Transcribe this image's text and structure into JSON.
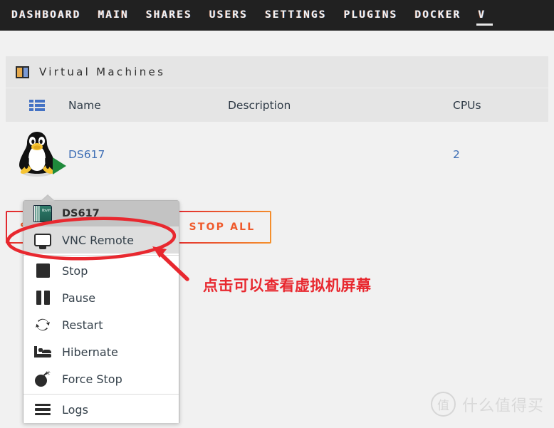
{
  "nav": {
    "items": [
      {
        "label": "DASHBOARD",
        "active": false
      },
      {
        "label": "MAIN",
        "active": false
      },
      {
        "label": "SHARES",
        "active": false
      },
      {
        "label": "USERS",
        "active": false
      },
      {
        "label": "SETTINGS",
        "active": false
      },
      {
        "label": "PLUGINS",
        "active": false
      },
      {
        "label": "DOCKER",
        "active": false
      },
      {
        "label": "V",
        "active": true
      }
    ]
  },
  "panel": {
    "title": "Virtual Machines",
    "icon": "panels-icon"
  },
  "table": {
    "headers": {
      "icon": "list-view-icon",
      "name": "Name",
      "description": "Description",
      "cpus": "CPUs"
    },
    "rows": [
      {
        "icon": "tux-penguin-icon",
        "state_icon": "play-triangle-icon",
        "name": "DS617",
        "description": "",
        "cpus": "2"
      }
    ]
  },
  "buttons": {
    "start_all": "START ALL",
    "stop_all": "STOP ALL"
  },
  "context_menu": {
    "header": {
      "label": "DS617",
      "icon": "libvirt-book-icon"
    },
    "items": [
      {
        "label": "VNC Remote",
        "icon": "monitor-icon",
        "highlight": true
      },
      {
        "label": "Stop",
        "icon": "stop-square-icon",
        "highlight": false
      },
      {
        "label": "Pause",
        "icon": "pause-bars-icon",
        "highlight": false
      },
      {
        "label": "Restart",
        "icon": "restart-arrows-icon",
        "highlight": false
      },
      {
        "label": "Hibernate",
        "icon": "bed-icon",
        "highlight": false
      },
      {
        "label": "Force Stop",
        "icon": "bomb-icon",
        "highlight": false
      },
      {
        "label": "Logs",
        "icon": "logs-lines-icon",
        "highlight": false
      }
    ]
  },
  "annotation": {
    "text": "点击可以查看虚拟机屏幕",
    "color": "#e8282f",
    "ellipse_target": "VNC Remote",
    "arrow": "points-up-left"
  },
  "watermark": {
    "badge": "值",
    "text": "什么值得买"
  },
  "colors": {
    "nav_bg": "#212121",
    "page_bg": "#f1f1f1",
    "header_bg": "#e5e5e5",
    "link": "#3f6fb5",
    "button_gradient_start": "#e1262f",
    "button_gradient_end": "#f5922c",
    "annotation_red": "#e8282f",
    "menu_header_bg": "#c3c3c3",
    "menu_highlight_bg": "#dedede"
  }
}
